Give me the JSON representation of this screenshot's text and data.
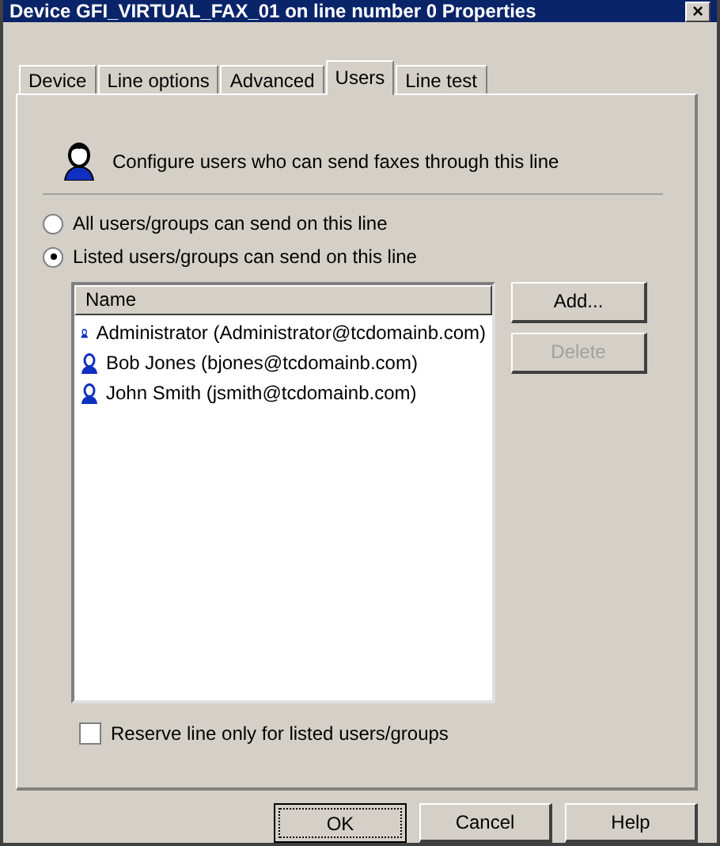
{
  "window": {
    "title": "Device GFI_VIRTUAL_FAX_01 on line number 0 Properties",
    "close": "×"
  },
  "tabs": [
    {
      "label": "Device",
      "selected": false
    },
    {
      "label": "Line options",
      "selected": false
    },
    {
      "label": "Advanced",
      "selected": false
    },
    {
      "label": "Users",
      "selected": true
    },
    {
      "label": "Line test",
      "selected": false
    }
  ],
  "header": {
    "text": "Configure users who can send faxes through this line"
  },
  "radios": [
    {
      "label": "All users/groups can send on this line",
      "selected": false
    },
    {
      "label": "Listed users/groups can send on this line",
      "selected": true
    }
  ],
  "user_list": {
    "columns": [
      "Name"
    ],
    "rows": [
      {
        "name": "Administrator (Administrator@tcdomainb.com)"
      },
      {
        "name": "Bob Jones (bjones@tcdomainb.com)"
      },
      {
        "name": "John Smith (jsmith@tcdomainb.com)"
      }
    ]
  },
  "list_buttons": [
    {
      "label": "Add...",
      "disabled": false
    },
    {
      "label": "Delete",
      "disabled": true
    }
  ],
  "reserve": {
    "label": "Reserve line only for listed users/groups",
    "checked": false
  },
  "buttons": [
    {
      "label": "OK",
      "default": true
    },
    {
      "label": "Cancel",
      "default": false
    },
    {
      "label": "Help",
      "default": false
    }
  ]
}
